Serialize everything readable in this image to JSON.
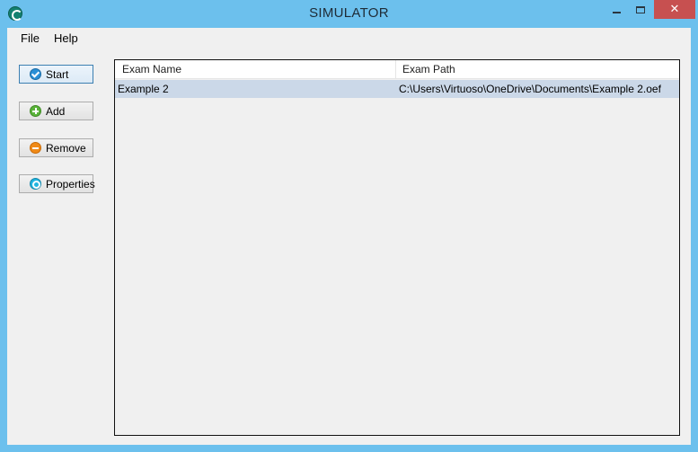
{
  "window": {
    "title": "SIMULATOR",
    "close_glyph": "✕"
  },
  "menu": {
    "items": [
      {
        "label": "File"
      },
      {
        "label": "Help"
      }
    ]
  },
  "sidebar": {
    "buttons": [
      {
        "label": "Start",
        "icon": "check-icon",
        "color": "#2a8fd6"
      },
      {
        "label": "Add",
        "icon": "plus-icon",
        "color": "#5ab33a"
      },
      {
        "label": "Remove",
        "icon": "minus-icon",
        "color": "#f08a16"
      },
      {
        "label": "Properties",
        "icon": "properties-icon",
        "color": "#21b5e0"
      }
    ]
  },
  "exam_list": {
    "columns": [
      "Exam Name",
      "Exam Path"
    ],
    "rows": [
      {
        "name": "Example 2",
        "path": "C:\\Users\\Virtuoso\\OneDrive\\Documents\\Example 2.oef",
        "selected": true
      }
    ]
  },
  "colors": {
    "titlebar": "#6cc0ed",
    "close_button": "#c75050",
    "selected_row": "#cbd8e8"
  }
}
